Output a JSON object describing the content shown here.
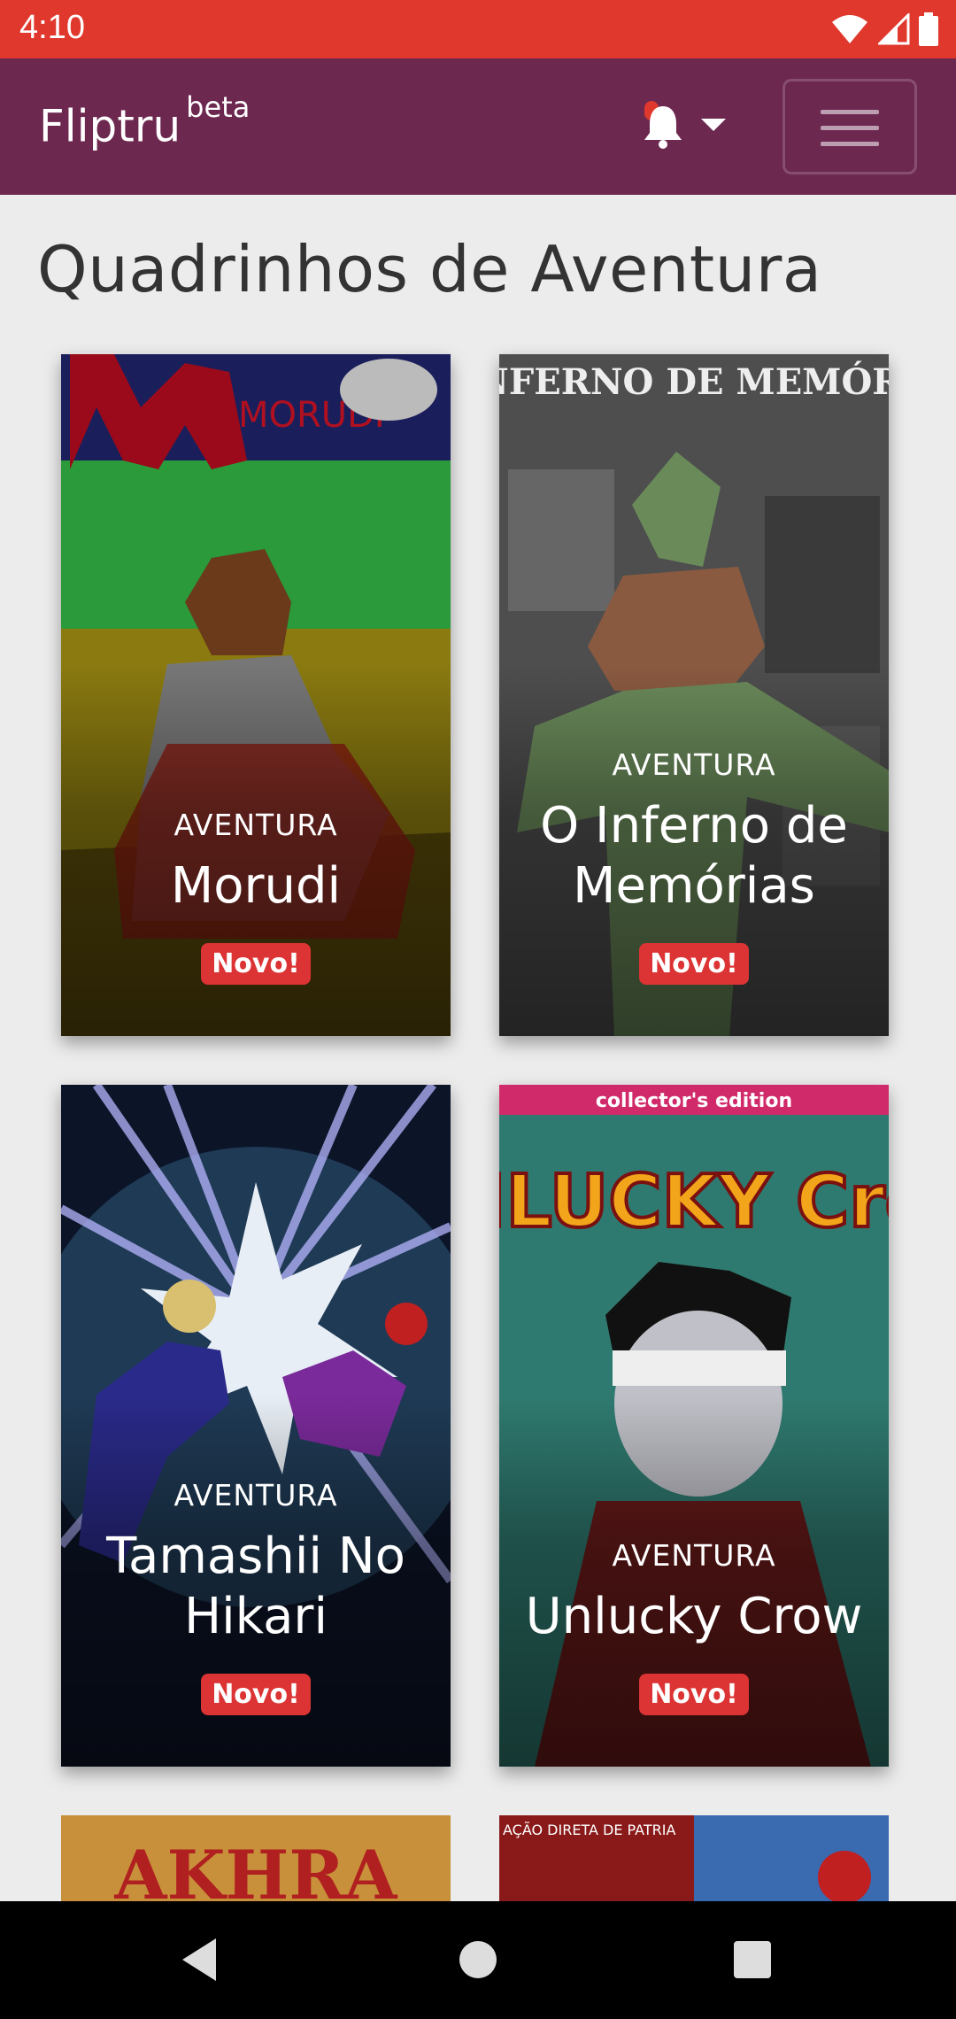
{
  "status_bar": {
    "time": "4:10"
  },
  "navbar": {
    "brand": "Fliptru",
    "brand_suffix": "beta"
  },
  "page": {
    "title": "Quadrinhos de Aventura"
  },
  "cards": [
    {
      "category": "AVENTURA",
      "title": "Morudi",
      "badge": "Novo!",
      "cover_text": "MORUDI"
    },
    {
      "category": "AVENTURA",
      "title": "O Inferno de Memórias",
      "badge": "Novo!",
      "cover_text": "O INFERNO DE MEMÓRIAS"
    },
    {
      "category": "AVENTURA",
      "title": "Tamashii No Hikari",
      "badge": "Novo!"
    },
    {
      "category": "AVENTURA",
      "title": "Unlucky Crow",
      "badge": "Novo!",
      "cover_text": "collector's edition",
      "cover_title": "UNLUCKY Crow"
    }
  ],
  "partial_cards": [
    {
      "cover_text": "AKHRA"
    },
    {
      "cover_text": "AÇÃO DIRETA DE PATRIA"
    }
  ],
  "colors": {
    "status_bar": "#e0382c",
    "navbar": "#6d2850",
    "badge": "#dc3434"
  }
}
